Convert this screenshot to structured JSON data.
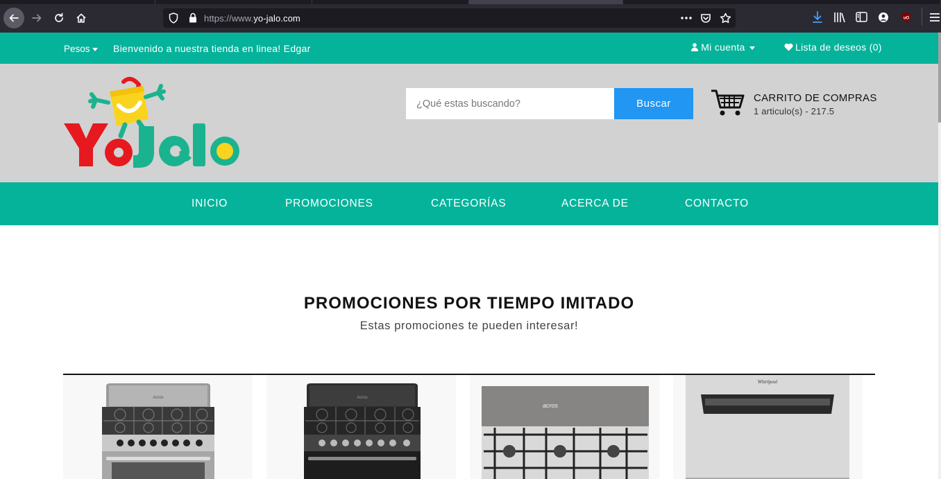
{
  "browser": {
    "url_scheme": "https://www.",
    "url_host": "yo-jalo.com"
  },
  "topbar": {
    "currency": "Pesos",
    "welcome": "Bienvenido a nuestra tienda en linea! Edgar",
    "account": "Mi cuenta",
    "wishlist": "Lista de deseos (0)"
  },
  "header": {
    "logo_text": "YoJ@lo",
    "search_placeholder": "¿Qué estas buscando?",
    "search_button": "Buscar",
    "cart_title": "CARRITO DE COMPRAS",
    "cart_summary": "1 articulo(s) - 217.5"
  },
  "nav": {
    "items": [
      "INICIO",
      "PROMOCIONES",
      "CATEGORÍAS",
      "ACERCA DE",
      "CONTACTO"
    ]
  },
  "promotions": {
    "title": "PROMOCIONES POR TIEMPO IMITADO",
    "subtitle": "Estas promociones te pueden interesar!",
    "products": [
      {
        "kind": "stove-stainless",
        "brand": "Acros"
      },
      {
        "kind": "stove-black",
        "brand": "Acros"
      },
      {
        "kind": "cooktop",
        "brand": "acros"
      },
      {
        "kind": "fridge",
        "brand": "Whirlpool"
      }
    ]
  },
  "colors": {
    "brand_teal": "#05b39b",
    "header_gray": "#d2d2d2",
    "search_blue": "#2196f3"
  }
}
